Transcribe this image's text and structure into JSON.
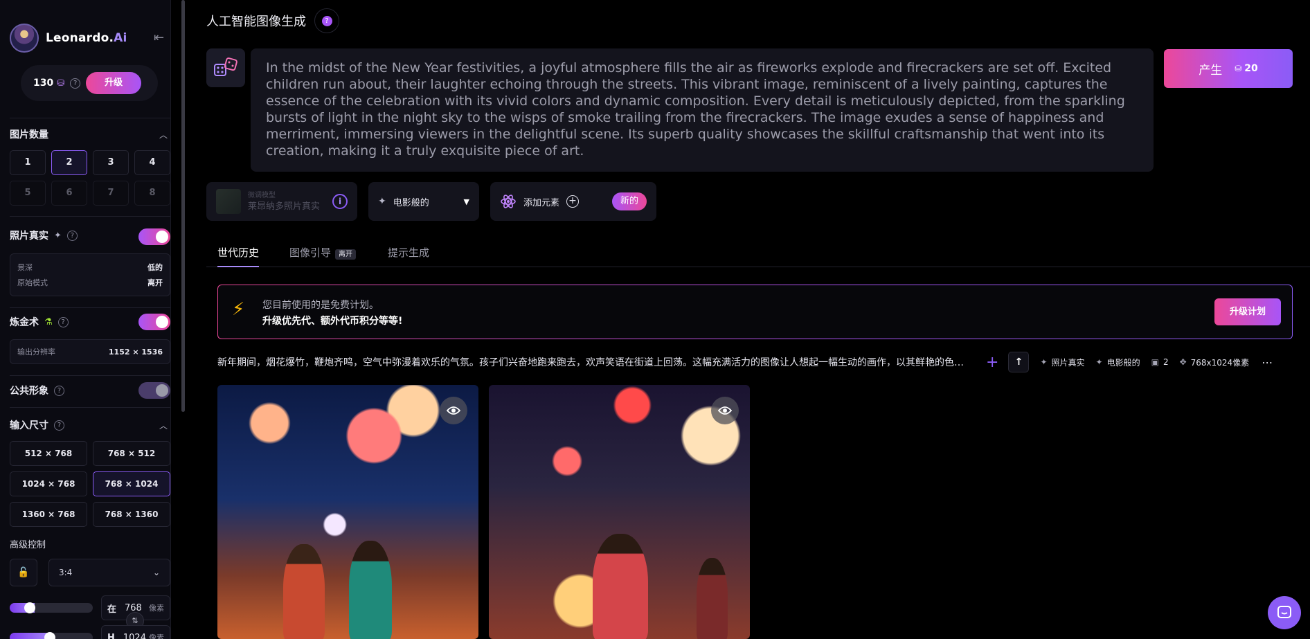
{
  "sidebar": {
    "brand": {
      "name": "Leonardo.",
      "suffix": "Ai"
    },
    "credits": {
      "count": "130",
      "upgrade_label": "升级"
    },
    "image_count": {
      "title": "图片数量",
      "options": [
        "1",
        "2",
        "3",
        "4",
        "5",
        "6",
        "7",
        "8"
      ],
      "selected": "2"
    },
    "photo_real": {
      "title": "照片真实",
      "enabled": true,
      "depth_label": "景深",
      "depth_value": "低的",
      "raw_label": "原始模式",
      "raw_value": "离开"
    },
    "alchemy": {
      "title": "炼金术",
      "enabled": true,
      "res_label": "输出分辨率",
      "res_value": "1152 × 1536"
    },
    "public": {
      "title": "公共形象",
      "enabled": false
    },
    "input_size": {
      "title": "输入尺寸",
      "options": [
        "512 × 768",
        "768 × 512",
        "1024 × 768",
        "768 × 1024",
        "1360 × 768",
        "768 × 1360"
      ],
      "selected": "768 × 1024"
    },
    "advanced": {
      "title": "高级控制",
      "ratio": "3:4",
      "width_label": "在",
      "width_value": "768",
      "height_label": "H",
      "height_value": "1024",
      "unit": "像素"
    }
  },
  "main": {
    "title": "人工智能图像生成",
    "prompt": "In the midst of the New Year festivities, a joyful atmosphere fills the air as fireworks explode and firecrackers are set off. Excited children run about, their laughter echoing through the streets. This vibrant image, reminiscent of a lively painting, captures the essence of the celebration with its vivid colors and dynamic composition. Every detail is meticulously depicted, from the sparkling bursts of light in the night sky to the wisps of smoke trailing from the firecrackers. The image exudes a sense of happiness and merriment, immersing viewers in the delightful scene. Its superb quality showcases the skillful craftsmanship that went into its creation, making it a truly exquisite piece of art.",
    "generate": {
      "label": "产生",
      "cost": "20"
    },
    "model": {
      "line1": "微调模型",
      "line2": "莱昂纳多照片真实"
    },
    "style": "电影般的",
    "elements": {
      "label": "添加元素",
      "badge": "新的"
    },
    "tabs": [
      {
        "label": "世代历史"
      },
      {
        "label": "图像引导",
        "badge": "离开"
      },
      {
        "label": "提示生成"
      }
    ],
    "banner": {
      "line1": "您目前使用的是免费计划。",
      "line2": "升级优先代、额外代币积分等等!",
      "button": "升级计划"
    },
    "generation": {
      "prompt": "新年期间，烟花爆竹，鞭炮齐鸣，空气中弥漫着欢乐的气氛。孩子们兴奋地跑来跑去，欢声笑语在街道上回荡。这幅充满活力的图像让人想起一幅生动的画作，以其鲜艳的色彩和动感的构图捕捉到了节日的精髓。",
      "tags": [
        "照片真实",
        "电影般的",
        "2",
        "768x1024像素"
      ]
    }
  },
  "colors": {
    "accent": "#8b5cf6",
    "pink": "#ec4899",
    "bolt": "#f5b50a"
  }
}
